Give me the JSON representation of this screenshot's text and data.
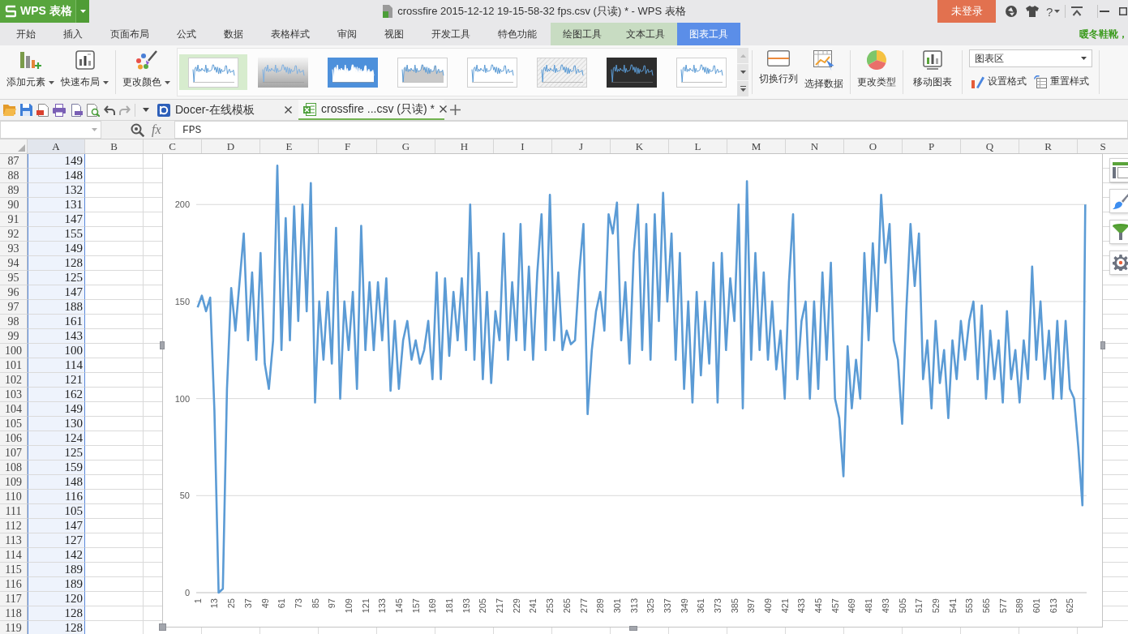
{
  "title_bar": {
    "app_name": "WPS 表格",
    "document_title": "crossfire 2015-12-12 19-15-58-32 fps.csv (只读) * - WPS 表格",
    "login_button": "未登录",
    "help_label": "?"
  },
  "menu_tabs": [
    {
      "label": "开始",
      "kind": "main",
      "selected": false
    },
    {
      "label": "插入",
      "kind": "main",
      "selected": false
    },
    {
      "label": "页面布局",
      "kind": "main",
      "selected": false
    },
    {
      "label": "公式",
      "kind": "main",
      "selected": false
    },
    {
      "label": "数据",
      "kind": "main",
      "selected": false
    },
    {
      "label": "表格样式",
      "kind": "main",
      "selected": false
    },
    {
      "label": "审阅",
      "kind": "main",
      "selected": false
    },
    {
      "label": "视图",
      "kind": "main",
      "selected": false
    },
    {
      "label": "开发工具",
      "kind": "main",
      "selected": false
    },
    {
      "label": "特色功能",
      "kind": "main",
      "selected": false
    },
    {
      "label": "绘图工具",
      "kind": "context",
      "selected": false
    },
    {
      "label": "文本工具",
      "kind": "context",
      "selected": false
    },
    {
      "label": "图表工具",
      "kind": "context",
      "selected": true
    }
  ],
  "promo_text": "暖冬鞋靴，",
  "ribbon": {
    "add_element": "添加元素",
    "quick_layout": "快速布局",
    "change_color": "更改颜色",
    "styles": [
      {
        "kind": "white",
        "selected": true
      },
      {
        "kind": "silver",
        "selected": false
      },
      {
        "kind": "blue",
        "selected": false
      },
      {
        "kind": "shaded",
        "selected": false
      },
      {
        "kind": "white",
        "selected": false
      },
      {
        "kind": "hatched",
        "selected": false
      },
      {
        "kind": "dark",
        "selected": false
      },
      {
        "kind": "white",
        "selected": false
      }
    ],
    "switch_row_column": "切换行列",
    "select_data": "选择数据",
    "change_type": "更改类型",
    "move_chart": "移动图表",
    "element_select": "图表区",
    "format_selection": "设置格式",
    "reset_style": "重置样式"
  },
  "doc_tabs": [
    {
      "label": "Docer-在线模板",
      "kind": "template",
      "selected": false
    },
    {
      "label": "crossfire ...csv (只读) *",
      "kind": "spreadsheet",
      "selected": true
    }
  ],
  "formula_bar": {
    "function_label": "fx",
    "value": "FPS"
  },
  "sheet": {
    "columns": [
      {
        "label": "A",
        "selected": true
      },
      {
        "label": "B",
        "selected": false
      },
      {
        "label": "C",
        "selected": false
      },
      {
        "label": "D",
        "selected": false
      },
      {
        "label": "E",
        "selected": false
      },
      {
        "label": "F",
        "selected": false
      },
      {
        "label": "G",
        "selected": false
      },
      {
        "label": "H",
        "selected": false
      },
      {
        "label": "I",
        "selected": false
      },
      {
        "label": "J",
        "selected": false
      },
      {
        "label": "K",
        "selected": false
      },
      {
        "label": "L",
        "selected": false
      },
      {
        "label": "M",
        "selected": false
      },
      {
        "label": "N",
        "selected": false
      },
      {
        "label": "O",
        "selected": false
      },
      {
        "label": "P",
        "selected": false
      },
      {
        "label": "Q",
        "selected": false
      },
      {
        "label": "R",
        "selected": false
      },
      {
        "label": "S",
        "selected": false
      }
    ],
    "rows": [
      {
        "number": "87",
        "value": "149"
      },
      {
        "number": "88",
        "value": "148"
      },
      {
        "number": "89",
        "value": "132"
      },
      {
        "number": "90",
        "value": "131"
      },
      {
        "number": "91",
        "value": "147"
      },
      {
        "number": "92",
        "value": "155"
      },
      {
        "number": "93",
        "value": "149"
      },
      {
        "number": "94",
        "value": "128"
      },
      {
        "number": "95",
        "value": "125"
      },
      {
        "number": "96",
        "value": "147"
      },
      {
        "number": "97",
        "value": "188"
      },
      {
        "number": "98",
        "value": "161"
      },
      {
        "number": "99",
        "value": "143"
      },
      {
        "number": "100",
        "value": "100"
      },
      {
        "number": "101",
        "value": "114"
      },
      {
        "number": "102",
        "value": "121"
      },
      {
        "number": "103",
        "value": "162"
      },
      {
        "number": "104",
        "value": "149"
      },
      {
        "number": "105",
        "value": "130"
      },
      {
        "number": "106",
        "value": "124"
      },
      {
        "number": "107",
        "value": "125"
      },
      {
        "number": "108",
        "value": "159"
      },
      {
        "number": "109",
        "value": "148"
      },
      {
        "number": "110",
        "value": "116"
      },
      {
        "number": "111",
        "value": "105"
      },
      {
        "number": "112",
        "value": "147"
      },
      {
        "number": "113",
        "value": "127"
      },
      {
        "number": "114",
        "value": "142"
      },
      {
        "number": "115",
        "value": "189"
      },
      {
        "number": "116",
        "value": "189"
      },
      {
        "number": "117",
        "value": "120"
      },
      {
        "number": "118",
        "value": "128"
      },
      {
        "number": "119",
        "value": "128"
      }
    ]
  },
  "chart": {
    "chart_data": {
      "type": "line",
      "grid": true,
      "xlim": [
        0,
        637
      ],
      "ylim": [
        0,
        226
      ],
      "yticks": [
        0,
        50,
        100,
        150,
        200
      ],
      "xticks": [
        1,
        13,
        25,
        37,
        49,
        61,
        73,
        85,
        97,
        109,
        121,
        133,
        145,
        157,
        169,
        181,
        193,
        205,
        217,
        229,
        241,
        253,
        265,
        277,
        289,
        301,
        313,
        325,
        337,
        349,
        361,
        373,
        385,
        397,
        409,
        421,
        433,
        445,
        457,
        469,
        481,
        493,
        505,
        517,
        529,
        541,
        553,
        565,
        577,
        589,
        601,
        613,
        625
      ],
      "x": [
        1,
        4,
        7,
        10,
        13,
        16,
        19,
        22,
        25,
        28,
        31,
        34,
        37,
        40,
        43,
        46,
        49,
        52,
        55,
        58,
        61,
        64,
        67,
        70,
        73,
        76,
        79,
        82,
        85,
        88,
        91,
        94,
        97,
        100,
        103,
        106,
        109,
        112,
        115,
        118,
        121,
        124,
        127,
        130,
        133,
        136,
        139,
        142,
        145,
        148,
        151,
        154,
        157,
        160,
        163,
        166,
        169,
        172,
        175,
        178,
        181,
        184,
        187,
        190,
        193,
        196,
        199,
        202,
        205,
        208,
        211,
        214,
        217,
        220,
        223,
        226,
        229,
        232,
        235,
        238,
        241,
        244,
        247,
        250,
        253,
        256,
        259,
        262,
        265,
        268,
        271,
        274,
        277,
        280,
        283,
        286,
        289,
        292,
        295,
        298,
        301,
        304,
        307,
        310,
        313,
        316,
        319,
        322,
        325,
        328,
        331,
        334,
        337,
        340,
        343,
        346,
        349,
        352,
        355,
        358,
        361,
        364,
        367,
        370,
        373,
        376,
        379,
        382,
        385,
        388,
        391,
        394,
        397,
        400,
        403,
        406,
        409,
        412,
        415,
        418,
        421,
        424,
        427,
        430,
        433,
        436,
        439,
        442,
        445,
        448,
        451,
        454,
        457,
        460,
        463,
        466,
        469,
        472,
        475,
        478,
        481,
        484,
        487,
        490,
        493,
        496,
        499,
        502,
        505,
        508,
        511,
        514,
        517,
        520,
        523,
        526,
        529,
        532,
        535,
        538,
        541,
        544,
        547,
        550,
        553,
        556,
        559,
        562,
        565,
        568,
        571,
        574,
        577,
        580,
        583,
        586,
        589,
        592,
        595,
        598,
        601,
        604,
        607,
        610,
        613,
        616,
        619,
        622,
        625,
        628,
        631,
        634,
        636
      ],
      "series": [
        {
          "color": "#5b9bd5",
          "values": [
            147,
            153,
            145,
            152,
            94,
            0,
            2,
            105,
            157,
            135,
            160,
            185,
            130,
            165,
            120,
            175,
            118,
            105,
            130,
            220,
            125,
            193,
            130,
            199,
            140,
            200,
            145,
            211,
            98,
            150,
            120,
            155,
            118,
            188,
            100,
            150,
            125,
            155,
            105,
            189,
            125,
            160,
            125,
            160,
            130,
            162,
            104,
            140,
            105,
            130,
            140,
            120,
            130,
            118,
            125,
            140,
            110,
            165,
            110,
            162,
            122,
            155,
            130,
            162,
            125,
            200,
            120,
            175,
            110,
            155,
            108,
            145,
            130,
            185,
            120,
            160,
            130,
            190,
            125,
            168,
            120,
            165,
            195,
            125,
            205,
            130,
            165,
            125,
            135,
            128,
            130,
            165,
            190,
            92,
            125,
            145,
            155,
            135,
            195,
            185,
            201,
            130,
            160,
            118,
            175,
            200,
            125,
            190,
            120,
            195,
            140,
            206,
            150,
            185,
            120,
            175,
            105,
            150,
            98,
            155,
            112,
            150,
            118,
            170,
            98,
            175,
            125,
            162,
            140,
            200,
            95,
            212,
            120,
            175,
            125,
            165,
            120,
            150,
            115,
            135,
            100,
            160,
            195,
            110,
            140,
            150,
            100,
            150,
            105,
            165,
            120,
            170,
            100,
            90,
            60,
            127,
            95,
            120,
            100,
            175,
            130,
            180,
            145,
            205,
            170,
            190,
            130,
            120,
            87,
            145,
            190,
            158,
            185,
            110,
            130,
            95,
            140,
            108,
            125,
            90,
            130,
            110,
            140,
            120,
            140,
            150,
            110,
            148,
            100,
            135,
            110,
            130,
            98,
            145,
            110,
            125,
            98,
            130,
            110,
            168,
            120,
            150,
            110,
            135,
            100,
            140,
            100,
            140,
            105,
            100,
            75,
            45,
            200
          ]
        }
      ]
    }
  }
}
